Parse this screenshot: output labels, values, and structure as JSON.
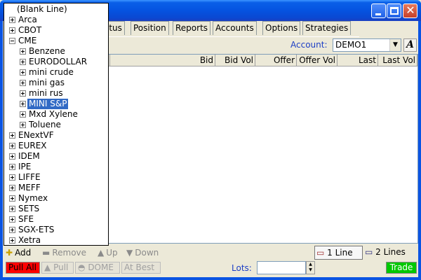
{
  "window": {
    "controls": {
      "minimize": "minimize-icon",
      "maximize": "maximize-icon",
      "close": "close-icon"
    }
  },
  "tabs": [
    "atus",
    "Position",
    "Reports",
    "Accounts",
    "Options",
    "Strategies"
  ],
  "account": {
    "label": "Account:",
    "value": "DEMO1",
    "font_button": "A"
  },
  "columns": [
    "Bid",
    "Bid Vol",
    "Offer",
    "Offer Vol",
    "Last",
    "Last Vol"
  ],
  "tree": {
    "blank": "(Blank Line)",
    "items": [
      {
        "label": "Arca",
        "level": 0,
        "expanded": false
      },
      {
        "label": "CBOT",
        "level": 0,
        "expanded": false
      },
      {
        "label": "CME",
        "level": 0,
        "expanded": true
      },
      {
        "label": "Benzene",
        "level": 1,
        "expanded": false
      },
      {
        "label": "EURODOLLAR",
        "level": 1,
        "expanded": false
      },
      {
        "label": "mini crude",
        "level": 1,
        "expanded": false
      },
      {
        "label": "mini gas",
        "level": 1,
        "expanded": false
      },
      {
        "label": "mini rus",
        "level": 1,
        "expanded": false
      },
      {
        "label": "MINI S&P",
        "level": 1,
        "expanded": false,
        "selected": true
      },
      {
        "label": "Mxd Xylene",
        "level": 1,
        "expanded": false
      },
      {
        "label": "Toluene",
        "level": 1,
        "expanded": false
      },
      {
        "label": "ENextVF",
        "level": 0,
        "expanded": false
      },
      {
        "label": "EUREX",
        "level": 0,
        "expanded": false
      },
      {
        "label": "IDEM",
        "level": 0,
        "expanded": false
      },
      {
        "label": "IPE",
        "level": 0,
        "expanded": false
      },
      {
        "label": "LIFFE",
        "level": 0,
        "expanded": false
      },
      {
        "label": "MEFF",
        "level": 0,
        "expanded": false
      },
      {
        "label": "Nymex",
        "level": 0,
        "expanded": false
      },
      {
        "label": "SETS",
        "level": 0,
        "expanded": false
      },
      {
        "label": "SFE",
        "level": 0,
        "expanded": false
      },
      {
        "label": "SGX-ETS",
        "level": 0,
        "expanded": false
      },
      {
        "label": "Xetra",
        "level": 0,
        "expanded": false
      }
    ]
  },
  "toolbar": {
    "add": "Add",
    "remove": "Remove",
    "up": "Up",
    "down": "Down",
    "one_line": "1 Line",
    "two_lines": "2 Lines"
  },
  "actions": {
    "pull_all": "Pull All",
    "pull": "Pull",
    "dome": "DOME",
    "at_best": "At Best",
    "lots_label": "Lots:",
    "lots_value": "",
    "trade": "Trade"
  },
  "colors": {
    "title_bar": "#0553e0",
    "pull_all_bg": "#ff0000",
    "trade_bg": "#00c800",
    "selection": "#316ac5",
    "label_blue": "#1c3ec5"
  }
}
